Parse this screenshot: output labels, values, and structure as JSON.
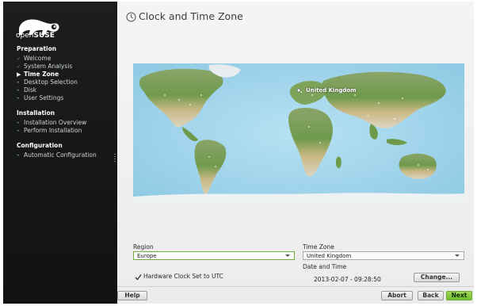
{
  "brand": {
    "logo_text_light": "open",
    "logo_text_bold": "SUSE"
  },
  "sidebar": {
    "sections": [
      {
        "title": "Preparation",
        "items": [
          {
            "label": "Welcome",
            "state": "done",
            "marker": "✓"
          },
          {
            "label": "System Analysis",
            "state": "done",
            "marker": "✓"
          },
          {
            "label": "Time Zone",
            "state": "active",
            "marker": "▶"
          },
          {
            "label": "Desktop Selection",
            "state": "todo",
            "marker": "•"
          },
          {
            "label": "Disk",
            "state": "todo",
            "marker": "•"
          },
          {
            "label": "User Settings",
            "state": "todo",
            "marker": "•"
          }
        ]
      },
      {
        "title": "Installation",
        "items": [
          {
            "label": "Installation Overview",
            "state": "todo",
            "marker": "•"
          },
          {
            "label": "Perform Installation",
            "state": "todo",
            "marker": "•"
          }
        ]
      },
      {
        "title": "Configuration",
        "items": [
          {
            "label": "Automatic Configuration",
            "state": "todo",
            "marker": "•"
          }
        ]
      }
    ]
  },
  "page": {
    "title": "Clock and Time Zone",
    "map_label": "United Kingdom"
  },
  "form": {
    "region_label": "Region",
    "region_value": "Europe",
    "timezone_label": "Time Zone",
    "timezone_value": "United Kingdom",
    "datetime_label": "Date and Time",
    "datetime_value": "2013-02-07 - 09:28:50",
    "change_button": "Change...",
    "hwclock_label": "Hardware Clock Set to UTC",
    "hwclock_checked": true
  },
  "footer": {
    "help": "Help",
    "abort": "Abort",
    "back": "Back",
    "next": "Next"
  },
  "colors": {
    "accent": "#6fbf2c",
    "sidebar_bg": "#161717"
  }
}
